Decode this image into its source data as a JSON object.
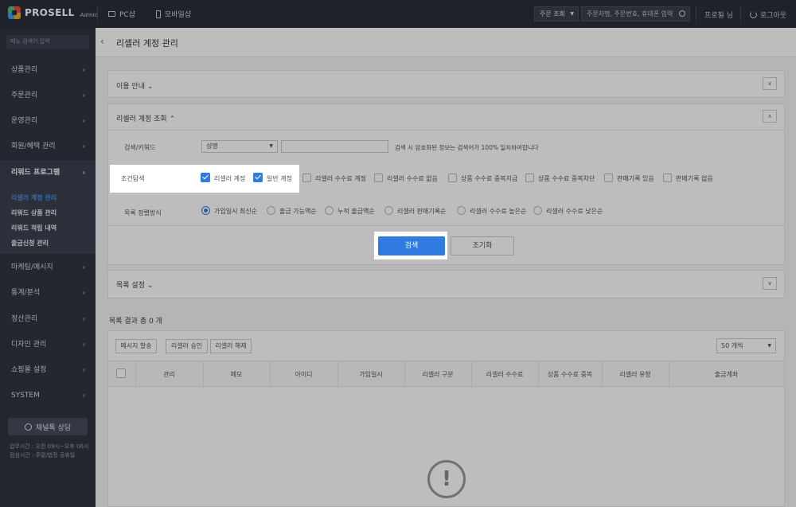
{
  "header": {
    "logo_text": "PROSELL",
    "logo_sub": "Admin",
    "pc_label": "PC샵",
    "mobile_label": "모바일샵",
    "order_select": "주문 조회",
    "search_placeholder": "주문자명, 주문번호, 휴대폰 입력",
    "profile": "프로필 님",
    "logout": "로그아웃"
  },
  "sidebar": {
    "search_placeholder": "메뉴 검색어 입력",
    "items": [
      {
        "label": "상품관리"
      },
      {
        "label": "주문관리"
      },
      {
        "label": "운영관리"
      },
      {
        "label": "회원/혜택 관리"
      },
      {
        "label": "리워드 프로그램"
      },
      {
        "label": "마케팅/메시지"
      },
      {
        "label": "통계/분석"
      },
      {
        "label": "정산관리"
      },
      {
        "label": "디자인 관리"
      },
      {
        "label": "쇼핑몰 설정"
      },
      {
        "label": "SYSTEM"
      }
    ],
    "submenu": [
      {
        "label": "리셀러 계정 관리"
      },
      {
        "label": "리워드 상품 관리"
      },
      {
        "label": "리워드 적립 내역"
      },
      {
        "label": "출금신청 관리"
      }
    ],
    "chat_label": "채널톡 상담",
    "hours_line1": "업무시간 : 오전 09시~오후 06시",
    "hours_line2": "점심시간 : 주말/법정 공휴일"
  },
  "page": {
    "title": "리셀러 계정 관리",
    "usage_guide": "이용 안내",
    "query_title": "리셀러 계정 조회",
    "list_settings": "목록 설정"
  },
  "filters": {
    "keyword_label": "검색/키워드",
    "keyword_select": "성명",
    "keyword_hint": "검색 시 암호화된 정보는 검색어가 100% 일치하여합니다",
    "cond_label": "조건탐색",
    "cond_options": [
      {
        "label": "리셀러 계정",
        "checked": true
      },
      {
        "label": "일반 계정",
        "checked": true
      },
      {
        "label": "리셀러 수수료 계정",
        "checked": false
      },
      {
        "label": "리셀러 수수료 없음",
        "checked": false
      },
      {
        "label": "상품 수수료 중복지급",
        "checked": false
      },
      {
        "label": "상품 수수료 중복차단",
        "checked": false
      },
      {
        "label": "판매기록 있음",
        "checked": false
      },
      {
        "label": "판매기록 없음",
        "checked": false
      }
    ],
    "sort_label": "목록 정렬방식",
    "sort_options": [
      {
        "label": "가입일시 최신순",
        "checked": true
      },
      {
        "label": "출금 가능액순",
        "checked": false
      },
      {
        "label": "누적 출금액순",
        "checked": false
      },
      {
        "label": "리셀러 판매기록순",
        "checked": false
      },
      {
        "label": "리셀러 수수료 높은순",
        "checked": false
      },
      {
        "label": "리셀러 수수료 낮은순",
        "checked": false
      }
    ],
    "search_btn": "검색",
    "reset_btn": "초기화"
  },
  "results": {
    "summary": "목록 결과 총 0 개",
    "actions": [
      "메시지 발송",
      "리셀러 승인",
      "리셀러 해제"
    ],
    "page_size": "50 개씩",
    "columns": [
      "관리",
      "메모",
      "아이디",
      "가입일시",
      "리셀러 구분",
      "리셀러 수수료",
      "상품 수수료 중복",
      "리셀러 유형",
      "출금계좌"
    ],
    "empty_icon": "!"
  },
  "icons": [
    "logo-icon",
    "pc-icon",
    "mobile-icon",
    "search-icon",
    "power-icon",
    "chevron-left-icon",
    "chevron-down-icon",
    "chat-icon",
    "warning-icon"
  ],
  "colors": {
    "accent": "#2f7be0",
    "header_bg": "#2a2f3a",
    "sidebar_bg": "#2f3542"
  }
}
